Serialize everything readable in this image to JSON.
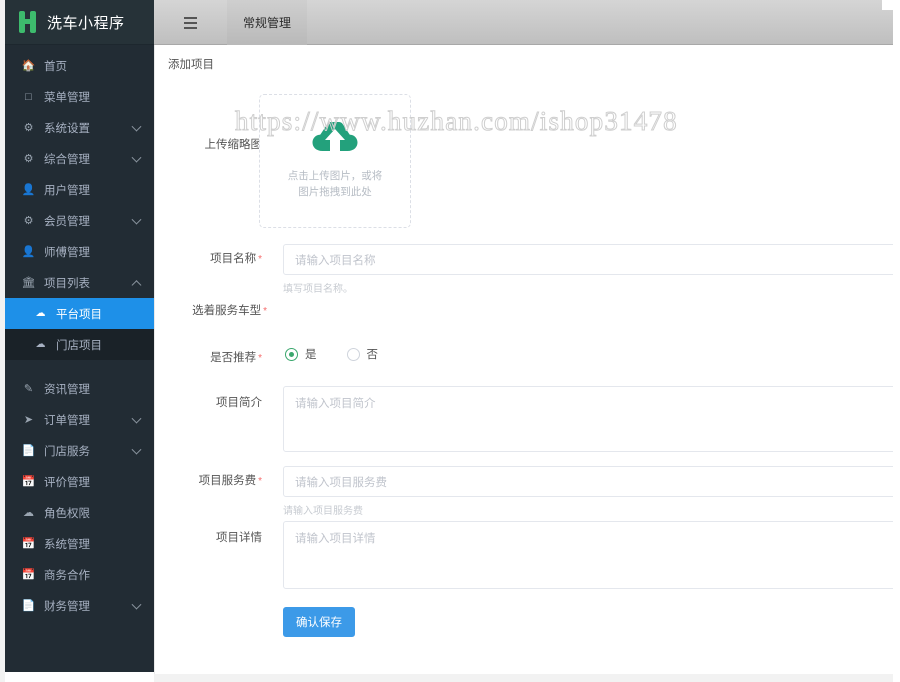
{
  "brand": {
    "title": "洗车小程序",
    "logo_color": "#3dbb6d"
  },
  "topbar": {
    "tabs": [
      {
        "label": "",
        "icon": "list-icon",
        "active": false
      },
      {
        "label": "常规管理",
        "icon": "",
        "active": true
      }
    ]
  },
  "sidebar": {
    "items": [
      {
        "label": "首页",
        "icon": "home-icon",
        "arrow": false
      },
      {
        "label": "菜单管理",
        "icon": "window-icon",
        "arrow": false
      },
      {
        "label": "系统设置",
        "icon": "gears-icon",
        "arrow": "down"
      },
      {
        "label": "综合管理",
        "icon": "gears-icon",
        "arrow": "down"
      },
      {
        "label": "用户管理",
        "icon": "user-icon",
        "arrow": false
      },
      {
        "label": "会员管理",
        "icon": "gears-icon",
        "arrow": "down"
      },
      {
        "label": "师傅管理",
        "icon": "user-icon",
        "arrow": false
      },
      {
        "label": "项目列表",
        "icon": "bank-icon",
        "arrow": "up"
      }
    ],
    "sub_items": [
      {
        "label": "平台项目",
        "icon": "cloud-icon",
        "active": true
      },
      {
        "label": "门店项目",
        "icon": "cloud-icon",
        "active": false
      }
    ],
    "items_after": [
      {
        "label": "资讯管理",
        "icon": "edit-icon",
        "arrow": false
      },
      {
        "label": "订单管理",
        "icon": "send-icon",
        "arrow": "down"
      },
      {
        "label": "门店服务",
        "icon": "file-icon",
        "arrow": "down"
      },
      {
        "label": "评价管理",
        "icon": "calendar-icon",
        "arrow": false
      },
      {
        "label": "角色权限",
        "icon": "cloud-icon",
        "arrow": false
      },
      {
        "label": "系统管理",
        "icon": "calendar-icon",
        "arrow": false
      },
      {
        "label": "商务合作",
        "icon": "calendar-icon",
        "arrow": false
      },
      {
        "label": "财务管理",
        "icon": "file-icon",
        "arrow": "down"
      }
    ],
    "active_color": "#1e90e8"
  },
  "main": {
    "page_title": "添加项目",
    "watermark": "https://www.huzhan.com/ishop31478",
    "form": {
      "upload": {
        "label": "上传缩略图",
        "icon": "cloud-upload-icon",
        "icon_color": "#23a17c",
        "text_line1": "点击上传图片，或将",
        "text_line2": "图片拖拽到此处"
      },
      "name": {
        "label": "项目名称",
        "required": true,
        "placeholder": "请输入项目名称",
        "value": "",
        "hint": "填写项目名称。"
      },
      "car_type": {
        "label": "选着服务车型",
        "required": true
      },
      "recommend": {
        "label": "是否推荐",
        "required": true,
        "options": [
          {
            "label": "是",
            "selected": true
          },
          {
            "label": "否",
            "selected": false
          }
        ]
      },
      "brief": {
        "label": "项目简介",
        "required": false,
        "placeholder": "请输入项目简介",
        "value": ""
      },
      "fee": {
        "label": "项目服务费",
        "required": true,
        "placeholder": "请输入项目服务费",
        "value": "",
        "hint": "请输入项目服务费"
      },
      "detail": {
        "label": "项目详情",
        "required": false,
        "placeholder": "请输入项目详情",
        "value": ""
      },
      "submit": {
        "label": "确认保存",
        "color": "#3c9ae8"
      }
    }
  }
}
